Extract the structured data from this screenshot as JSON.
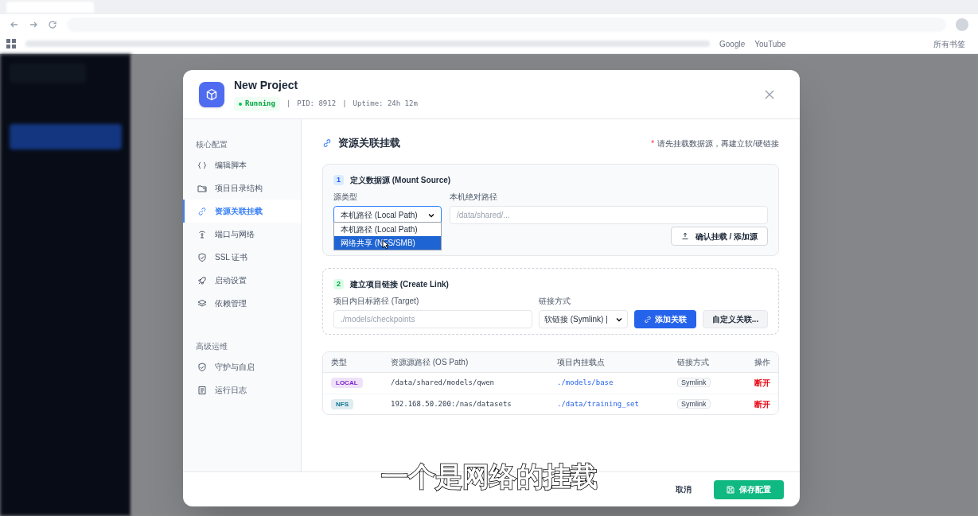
{
  "browser": {
    "bookmarks": [
      "Google",
      "YouTube"
    ],
    "all_bookmarks": "所有书签"
  },
  "dialog": {
    "title": "New Project",
    "status": "Running",
    "separators": [
      "|",
      "|"
    ],
    "pid": "PID: 8912",
    "uptime": "Uptime: 24h 12m",
    "nav": [
      {
        "heading": "核心配置",
        "items": [
          {
            "label": "编辑脚本",
            "selected": false
          },
          {
            "label": "项目目录结构",
            "selected": false
          },
          {
            "label": "资源关联挂载",
            "selected": true
          },
          {
            "label": "端口与网络",
            "selected": false
          },
          {
            "label": "SSL 证书",
            "selected": false
          },
          {
            "label": "启动设置",
            "selected": false
          },
          {
            "label": "依赖管理",
            "selected": false
          }
        ]
      },
      {
        "heading": "高级运维",
        "items": [
          {
            "label": "守护与自启",
            "selected": false
          },
          {
            "label": "运行日志",
            "selected": false
          }
        ]
      }
    ],
    "content": {
      "title": "资源关联挂载",
      "required_mark": "*",
      "note": "请先挂载数据源，再建立软/硬链接",
      "step1": {
        "number": "1",
        "title": "定义数据源 (Mount Source)",
        "type_label": "源类型",
        "type_value": "本机路径 (Local Path)",
        "options": [
          {
            "label": "本机路径 (Local Path)",
            "selected": false
          },
          {
            "label": "网络共享 (NFS/SMB)",
            "selected": true
          }
        ],
        "path_label": "本机绝对路径",
        "path_placeholder": "/data/shared/...",
        "confirm_button": "确认挂载 / 添加源"
      },
      "step2": {
        "number": "2",
        "title": "建立项目链接 (Create Link)",
        "target_label": "项目内目标路径 (Target)",
        "target_placeholder": "./models/checkpoints",
        "link_label": "链接方式",
        "link_value": "软链接 (Symlink) |",
        "add_button": "添加关联",
        "custom_button": "自定义关联..."
      },
      "table": {
        "columns": [
          "类型",
          "资源源路径 (OS Path)",
          "项目内挂载点",
          "链接方式",
          "操作"
        ],
        "rows": [
          {
            "type": "LOCAL",
            "color": "#7e22ce",
            "os_path": "/data/shared/models/qwen",
            "mount_point": "./models/base",
            "link": "Symlink",
            "action": "断开"
          },
          {
            "type": "NFS",
            "color": "#0e7490",
            "os_path": "192.168.50.200:/nas/datasets",
            "mount_point": "./data/training_set",
            "link": "Symlink",
            "action": "断开"
          }
        ]
      }
    },
    "footer": {
      "cancel": "取消",
      "save": "保存配置"
    }
  },
  "subtitle": "一个是网络的挂载"
}
